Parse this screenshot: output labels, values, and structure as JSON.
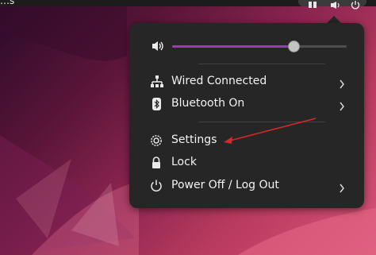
{
  "topbar": {
    "partial_label": "…s",
    "tray_icons": [
      "network-icon",
      "volume-icon",
      "power-icon"
    ]
  },
  "menu": {
    "volume": {
      "icon": "speaker-icon",
      "level": 0.7
    },
    "items": [
      {
        "label": "Wired Connected",
        "icon": "network-icon",
        "has_submenu": true
      },
      {
        "label": "Bluetooth On",
        "icon": "bluetooth-icon",
        "has_submenu": true
      },
      {
        "label": "Settings",
        "icon": "gear-icon",
        "has_submenu": false
      },
      {
        "label": "Lock",
        "icon": "lock-icon",
        "has_submenu": false
      },
      {
        "label": "Power Off / Log Out",
        "icon": "power-icon",
        "has_submenu": true
      }
    ]
  },
  "annotation": {
    "type": "red-arrow",
    "points_to": "Settings",
    "color": "#d62828"
  },
  "colors": {
    "accent": "#9b3ab0",
    "menu_bg": "#262626",
    "panel_bg": "#1c1c1c"
  }
}
